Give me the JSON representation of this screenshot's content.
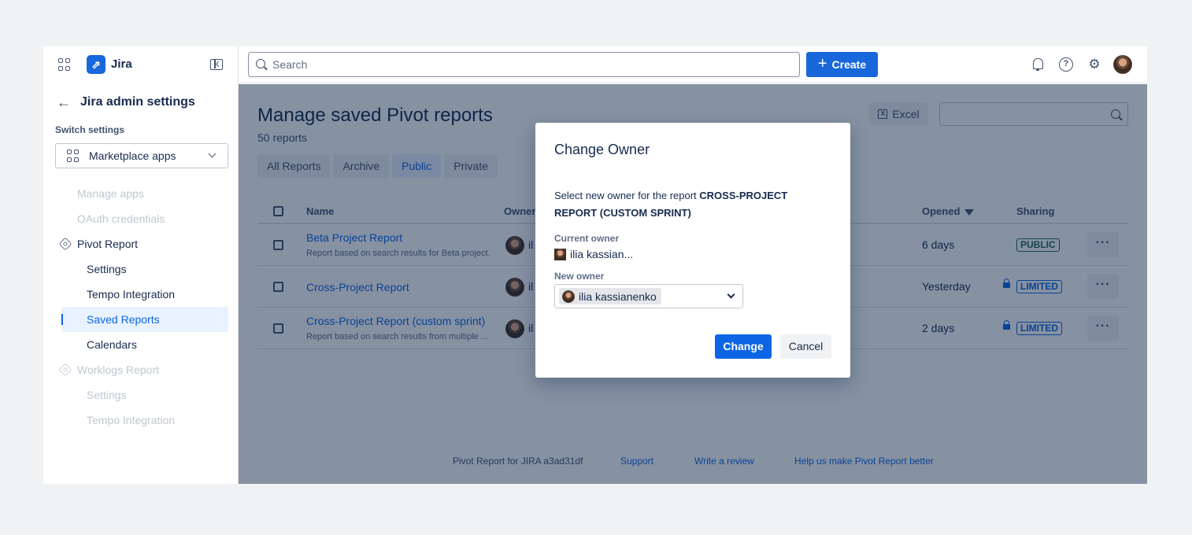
{
  "app": {
    "name": "Jira"
  },
  "search": {
    "placeholder": "Search"
  },
  "create_label": "Create",
  "sidebar": {
    "title": "Jira admin settings",
    "switch_label": "Switch settings",
    "switch_value": "Marketplace apps",
    "items": [
      {
        "label": "Manage apps"
      },
      {
        "label": "OAuth credentials"
      },
      {
        "label": "Pivot Report"
      },
      {
        "label": "Settings"
      },
      {
        "label": "Tempo Integration"
      },
      {
        "label": "Saved Reports"
      },
      {
        "label": "Calendars"
      },
      {
        "label": "Worklogs Report"
      },
      {
        "label": "Settings"
      },
      {
        "label": "Tempo Integration"
      }
    ]
  },
  "page": {
    "title": "Manage saved Pivot reports",
    "subtitle": "50 reports",
    "tabs": [
      "All Reports",
      "Archive",
      "Public",
      "Private"
    ],
    "excel_label": "Excel"
  },
  "table": {
    "headers": {
      "name": "Name",
      "owner": "Owner",
      "opened": "Opened",
      "sharing": "Sharing"
    },
    "rows": [
      {
        "name": "Beta Project Report",
        "desc": "Report based on search results for Beta project.",
        "owner": "il",
        "opened": "6 days",
        "sharing": "PUBLIC"
      },
      {
        "name": "Cross-Project Report",
        "desc": "",
        "owner": "il",
        "opened": "Yesterday",
        "sharing": "LIMITED"
      },
      {
        "name": "Cross-Project Report (custom sprint)",
        "desc": "Report based on search results from multiple ...",
        "owner": "il",
        "opened": "2 days",
        "sharing": "LIMITED"
      }
    ],
    "more_label": "···"
  },
  "footer": {
    "version": "Pivot Report for JIRA a3ad31df",
    "support": "Support",
    "review": "Write a review",
    "feedback": "Help us make Pivot Report better"
  },
  "modal": {
    "title": "Change Owner",
    "text_prefix": "Select new owner for the report ",
    "report_name": "CROSS-PROJECT REPORT (CUSTOM SPRINT)",
    "current_owner_label": "Current owner",
    "current_owner": "ilia kassian...",
    "new_owner_label": "New owner",
    "new_owner": "ilia kassianenko",
    "change_label": "Change",
    "cancel_label": "Cancel"
  },
  "colors": {
    "brand": "#1868db",
    "link": "#0c66e4",
    "overlay": "#091e42"
  }
}
